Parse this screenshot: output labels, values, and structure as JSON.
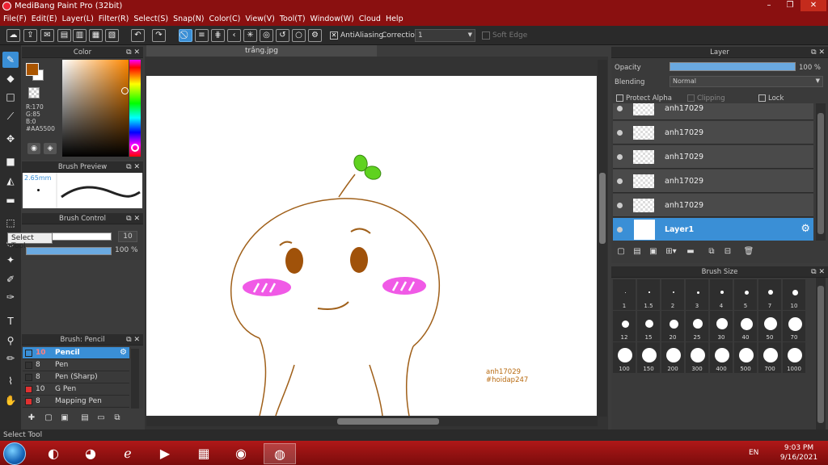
{
  "window": {
    "title": "MediBang Paint Pro (32bit)",
    "min": "–",
    "max": "❐",
    "close": "✕"
  },
  "menu": [
    "File(F)",
    "Edit(E)",
    "Layer(L)",
    "Filter(R)",
    "Select(S)",
    "Snap(N)",
    "Color(C)",
    "View(V)",
    "Tool(T)",
    "Window(W)",
    "Cloud",
    "Help"
  ],
  "toolbar": {
    "antialiasing_label": "AntiAliasing",
    "antialiasing_checked": "✕",
    "correction_label": "Correction",
    "correction_value": "1",
    "soft_edge_label": "Soft Edge"
  },
  "tooltip": "Select Tool",
  "panels": {
    "color": "Color",
    "brush_preview": "Brush Preview",
    "brush_control": "Brush Control",
    "brush_list": "Brush: Pencil",
    "layer": "Layer",
    "brush_size": "Brush Size"
  },
  "color": {
    "r": "R:170",
    "g": "G:85",
    "b": "B:0",
    "hex": "#AA5500",
    "fg": "#aa5500"
  },
  "brush_preview": {
    "size": "2.65mm"
  },
  "brush_control": {
    "size_value": "10",
    "opacity_value": "100 %"
  },
  "brushes": [
    {
      "size": "10",
      "name": "Pencil",
      "color": "#3a8fd6",
      "active": true
    },
    {
      "size": "8",
      "name": "Pen",
      "color": "#333333"
    },
    {
      "size": "8",
      "name": "Pen (Sharp)",
      "color": "#333333"
    },
    {
      "size": "10",
      "name": "G Pen",
      "color": "#e03030"
    },
    {
      "size": "8",
      "name": "Mapping Pen",
      "color": "#e03030"
    }
  ],
  "document": {
    "tab": "trắng.jpg",
    "watermark_line1": "anh17029",
    "watermark_line2": "#hoidap247"
  },
  "layer": {
    "opacity_label": "Opacity",
    "opacity_value": "100 %",
    "blending_label": "Blending",
    "blending_value": "Normal",
    "protect_alpha": "Protect Alpha",
    "clipping": "Clipping",
    "lock": "Lock",
    "layers": [
      "anh17029",
      "anh17029",
      "anh17029",
      "anh17029",
      "anh17029",
      "Layer1"
    ]
  },
  "brush_sizes": [
    "1",
    "1.5",
    "2",
    "3",
    "4",
    "5",
    "7",
    "10",
    "12",
    "15",
    "20",
    "25",
    "30",
    "40",
    "50",
    "70",
    "100",
    "150",
    "200",
    "300",
    "400",
    "500",
    "700",
    "1000"
  ],
  "status": "Select Tool",
  "tray": {
    "lang": "EN",
    "time": "9:03 PM",
    "date": "9/16/2021"
  }
}
